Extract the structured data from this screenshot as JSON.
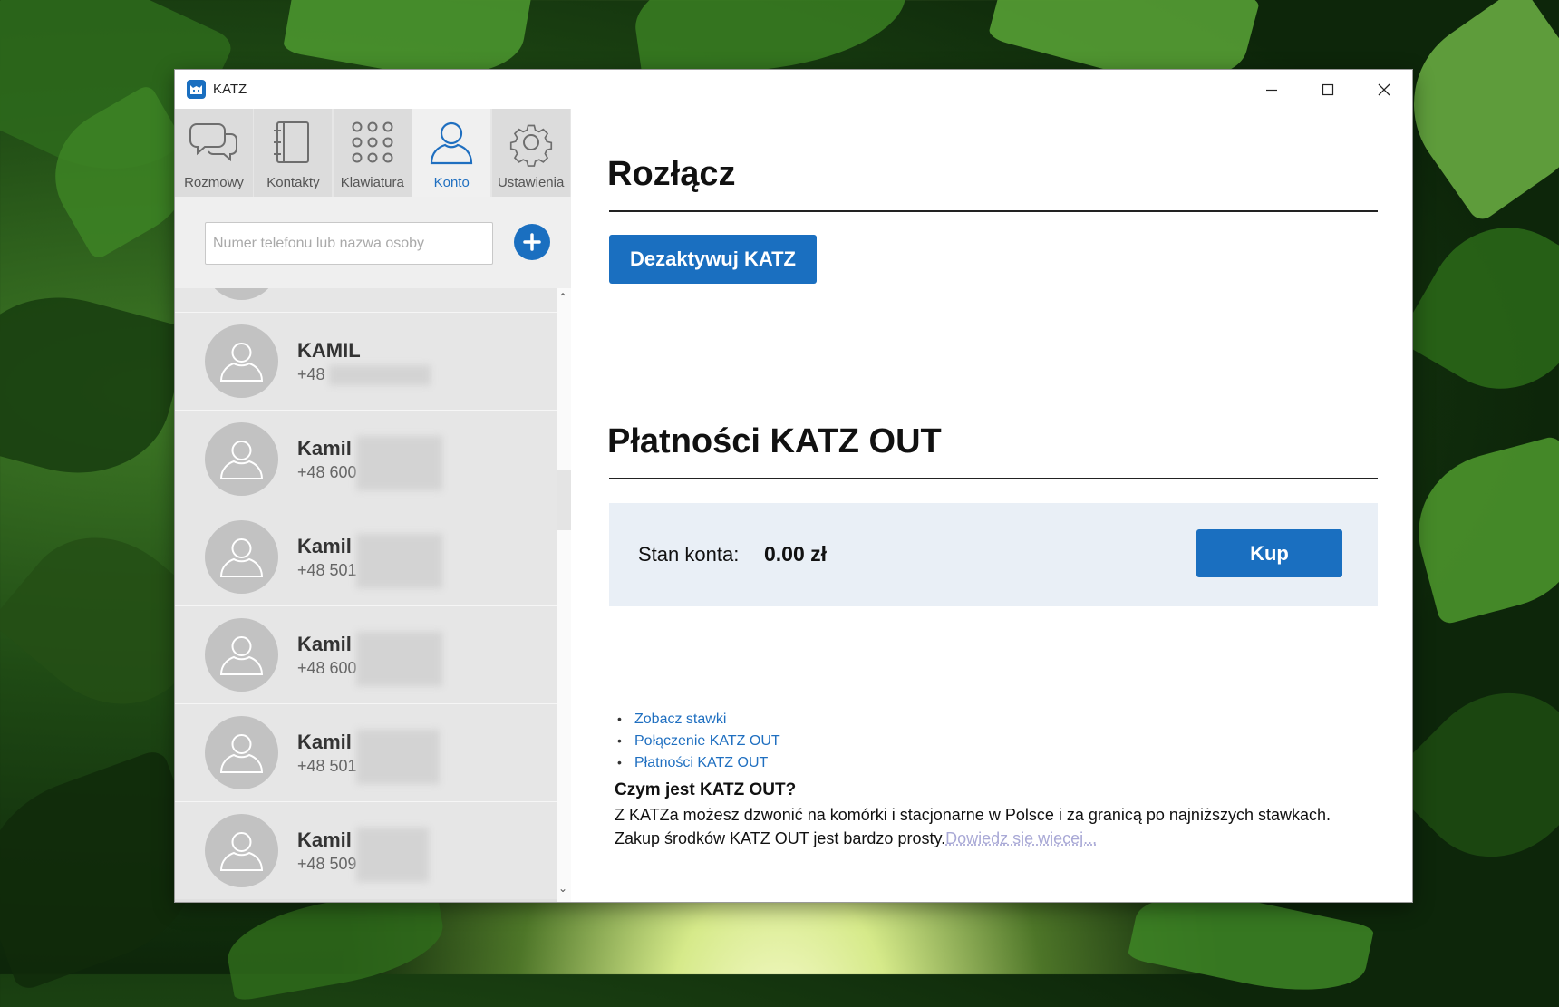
{
  "window": {
    "title": "KATZ"
  },
  "tabs": [
    {
      "label": "Rozmowy",
      "icon": "chat-icon"
    },
    {
      "label": "Kontakty",
      "icon": "address-book-icon"
    },
    {
      "label": "Klawiatura",
      "icon": "keypad-icon"
    },
    {
      "label": "Konto",
      "icon": "user-icon",
      "active": true
    },
    {
      "label": "Ustawienia",
      "icon": "gear-icon"
    }
  ],
  "search": {
    "placeholder": "Numer telefonu lub nazwa osoby",
    "value": ""
  },
  "contacts": [
    {
      "name": "KAMIL",
      "phone": "+48"
    },
    {
      "name": "Kamil",
      "phone": "+48 600"
    },
    {
      "name": "Kamil",
      "phone": "+48 501"
    },
    {
      "name": "Kamil",
      "phone": "+48 600"
    },
    {
      "name": "Kamil",
      "phone": "+48 501"
    },
    {
      "name": "Kamil",
      "phone": "+48 509"
    }
  ],
  "main": {
    "disconnect_heading": "Rozłącz",
    "deactivate_label": "Dezaktywuj KATZ",
    "payments_heading": "Płatności KATZ OUT",
    "balance_label": "Stan konta:",
    "balance_value": "0.00 zł",
    "buy_label": "Kup",
    "links": [
      "Zobacz stawki",
      "Połączenie KATZ OUT",
      "Płatności KATZ OUT"
    ],
    "what_title": "Czym jest KATZ OUT?",
    "what_text": "Z KATZa możesz dzwonić na komórki i stacjonarne w Polsce i za granicą po najniższych stawkach. Zakup środków KATZ OUT jest bardzo prosty.",
    "more_link": "Dowiedz się więcej..."
  },
  "colors": {
    "accent": "#1a6fc0",
    "balance_bg": "#e9eff6",
    "sidebar_bg": "#e6e6e6"
  }
}
